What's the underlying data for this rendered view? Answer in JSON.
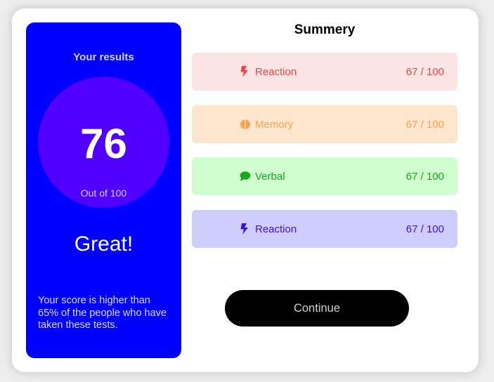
{
  "results": {
    "title": "Your results",
    "score": "76",
    "out_of": "Out of 100",
    "verdict": "Great!",
    "description": "Your score is higher than 65% of the people who have taken these tests."
  },
  "summary": {
    "title": "Summery",
    "items": [
      {
        "label": "Reaction",
        "value": "67 / 100",
        "icon": "lightning-icon",
        "bg": "#fde4e4",
        "color": "#f14545"
      },
      {
        "label": "Memory",
        "value": "67 / 100",
        "icon": "brain-icon",
        "bg": "#fee5cd",
        "color": "#f6a355"
      },
      {
        "label": "Verbal",
        "value": "67 / 100",
        "icon": "chat-bubble-icon",
        "bg": "#cfffcf",
        "color": "#16a816"
      },
      {
        "label": "Reaction",
        "value": "67 / 100",
        "icon": "lightning-icon",
        "bg": "#cfcdfd",
        "color": "#3b10e8"
      }
    ]
  },
  "continue_label": "Continue",
  "colors": {
    "panel": "#0000ff",
    "circle": "#5100ff",
    "button": "#000000"
  }
}
